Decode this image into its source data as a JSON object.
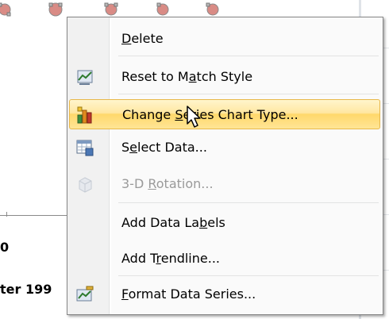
{
  "background": {
    "axis_zero_label": "0",
    "axis_year_label": "ter 199",
    "marker_color": "#d98b85"
  },
  "menu": {
    "items": [
      {
        "pre": "",
        "key": "D",
        "post": "elete",
        "icon": "none",
        "state": "normal"
      },
      {
        "pre": "Reset to M",
        "key": "a",
        "post": "tch Style",
        "icon": "reset-style-icon",
        "state": "normal"
      },
      {
        "pre": "Change ",
        "key": "S",
        "post": "eries Chart Type...",
        "icon": "bar-chart-icon",
        "state": "highlighted"
      },
      {
        "pre": "S",
        "key": "e",
        "post": "lect Data...",
        "icon": "select-data-icon",
        "state": "normal"
      },
      {
        "pre": "3-D ",
        "key": "R",
        "post": "otation...",
        "icon": "3d-rotation-icon",
        "state": "disabled"
      },
      {
        "pre": "Add Data La",
        "key": "b",
        "post": "els",
        "icon": "none",
        "state": "normal"
      },
      {
        "pre": "Add T",
        "key": "r",
        "post": "endline...",
        "icon": "none",
        "state": "normal"
      },
      {
        "pre": "",
        "key": "F",
        "post": "ormat Data Series...",
        "icon": "format-series-icon",
        "state": "normal"
      }
    ]
  },
  "colors": {
    "highlight_top": "#fff5cc",
    "highlight_bottom": "#ffd86b",
    "disabled_text": "#9a9a9a"
  }
}
